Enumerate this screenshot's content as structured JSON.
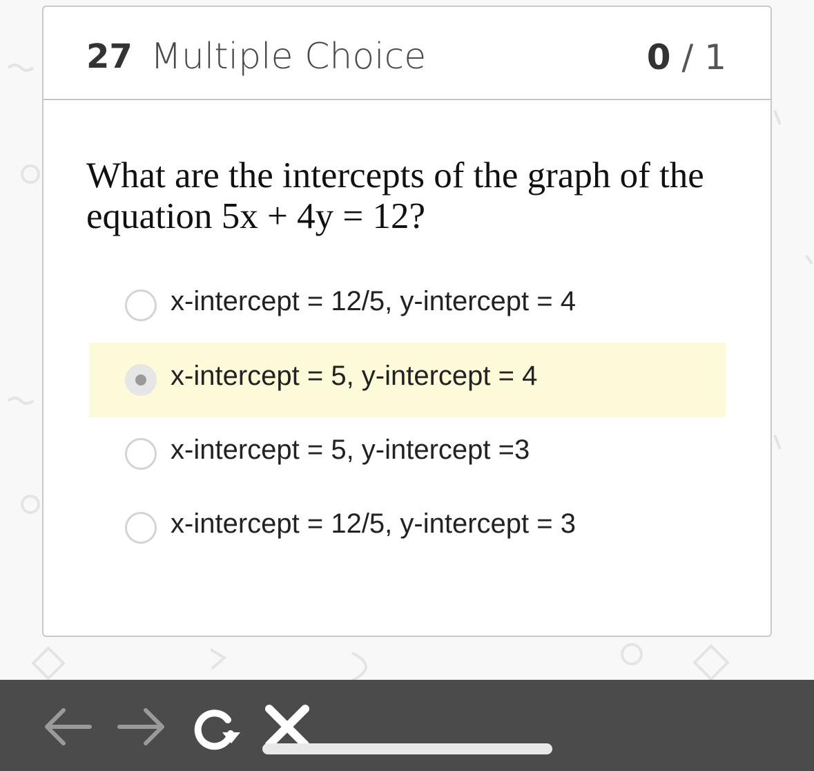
{
  "question": {
    "number": "27",
    "type": "Multiple Choice",
    "score_earned": "0",
    "score_separator": "/",
    "score_total": "1",
    "prompt_text": "What are the intercepts of the graph of the equation",
    "prompt_equation": "5x + 4y = 12?"
  },
  "choices": [
    {
      "label": "x-intercept = 12/5, y-intercept = 4",
      "selected": false
    },
    {
      "label": "x-intercept = 5, y-intercept = 4",
      "selected": true
    },
    {
      "label": "x-intercept = 5, y-intercept =3",
      "selected": false
    },
    {
      "label": "x-intercept = 12/5, y-intercept = 3",
      "selected": false
    }
  ],
  "colors": {
    "selected_highlight": "#fcfad8",
    "toolbar_bg": "#4b4b4b",
    "card_border": "#c9c9c9"
  },
  "toolbar": {
    "icons": [
      "back-arrow-icon",
      "forward-arrow-icon",
      "refresh-icon",
      "close-icon"
    ]
  }
}
